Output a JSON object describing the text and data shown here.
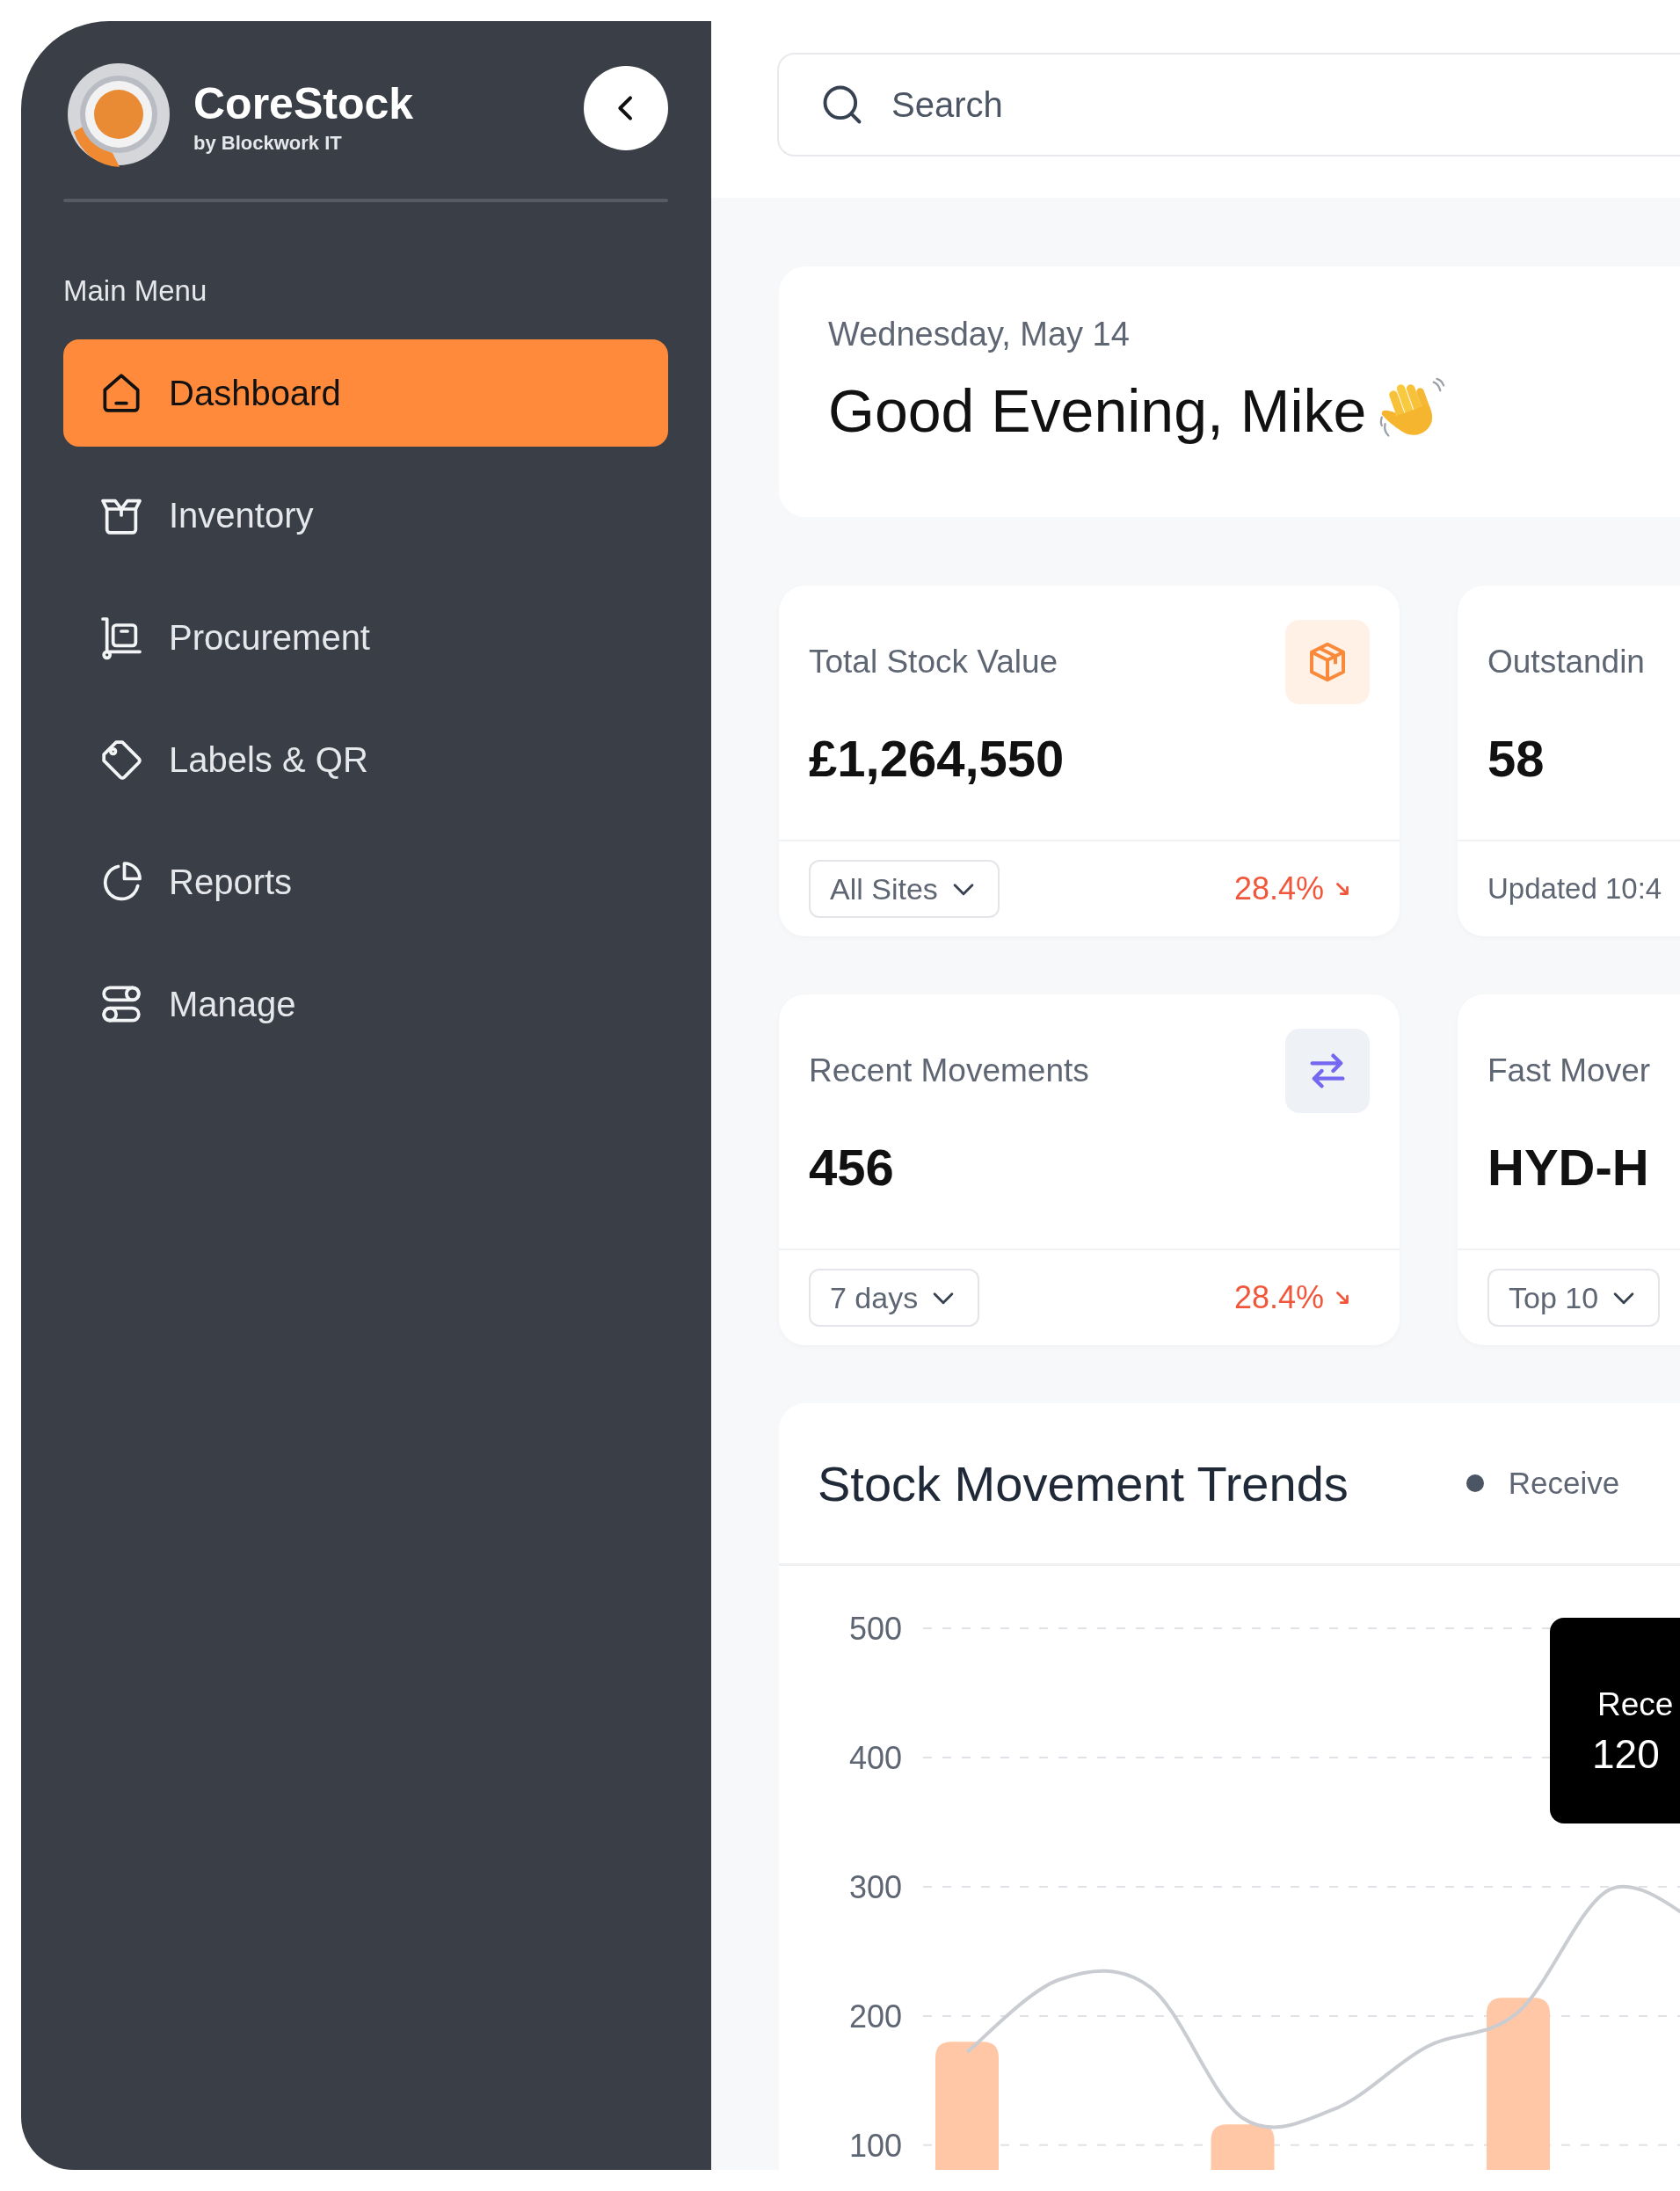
{
  "brand": {
    "name": "CoreStock",
    "tagline": "by Blockwork IT"
  },
  "sidebar": {
    "section_label": "Main Menu",
    "items": [
      {
        "label": "Dashboard",
        "kind": "home",
        "selected": true
      },
      {
        "label": "Inventory",
        "kind": "box",
        "selected": false
      },
      {
        "label": "Procurement",
        "kind": "trolley",
        "selected": false
      },
      {
        "label": "Labels & QR",
        "kind": "tag",
        "selected": false
      },
      {
        "label": "Reports",
        "kind": "pie",
        "selected": false
      },
      {
        "label": "Manage",
        "kind": "toggles",
        "selected": false
      }
    ]
  },
  "search": {
    "placeholder": "Search"
  },
  "greeting": {
    "date": "Wednesday, May 14",
    "message": "Good Evening, Mike"
  },
  "stat_cards": [
    {
      "title": "Total Stock Value",
      "value": "£1,264,550",
      "kind": "cube",
      "filter": "All Sites",
      "change": "28.4%"
    },
    {
      "title": "Outstandin",
      "value": "58",
      "note": "Updated 10:4"
    },
    {
      "title": "Recent Movements",
      "value": "456",
      "kind": "swap",
      "filter": "7 days",
      "change": "28.4%"
    },
    {
      "title": "Fast Mover",
      "value": "HYD-H",
      "filter": "Top 10"
    }
  ],
  "chart": {
    "title": "Stock Movement Trends",
    "legend": [
      {
        "label": "Receive"
      }
    ],
    "tooltip": {
      "label": "Rece",
      "value": "120"
    },
    "chart_data": {
      "type": "bar",
      "ylim": [
        72,
        500
      ],
      "yticks": [
        100,
        200,
        300,
        400,
        500
      ],
      "grid": true,
      "series": [
        {
          "color": "#ffc7a6",
          "values": [
            180,
            null,
            null,
            116,
            null,
            null,
            214,
            null,
            null
          ]
        },
        {
          "type": "line",
          "color": "#c9ccd1",
          "values": [
            172,
            228,
            222,
            121,
            128,
            176,
            203,
            298,
            270
          ]
        }
      ]
    }
  }
}
